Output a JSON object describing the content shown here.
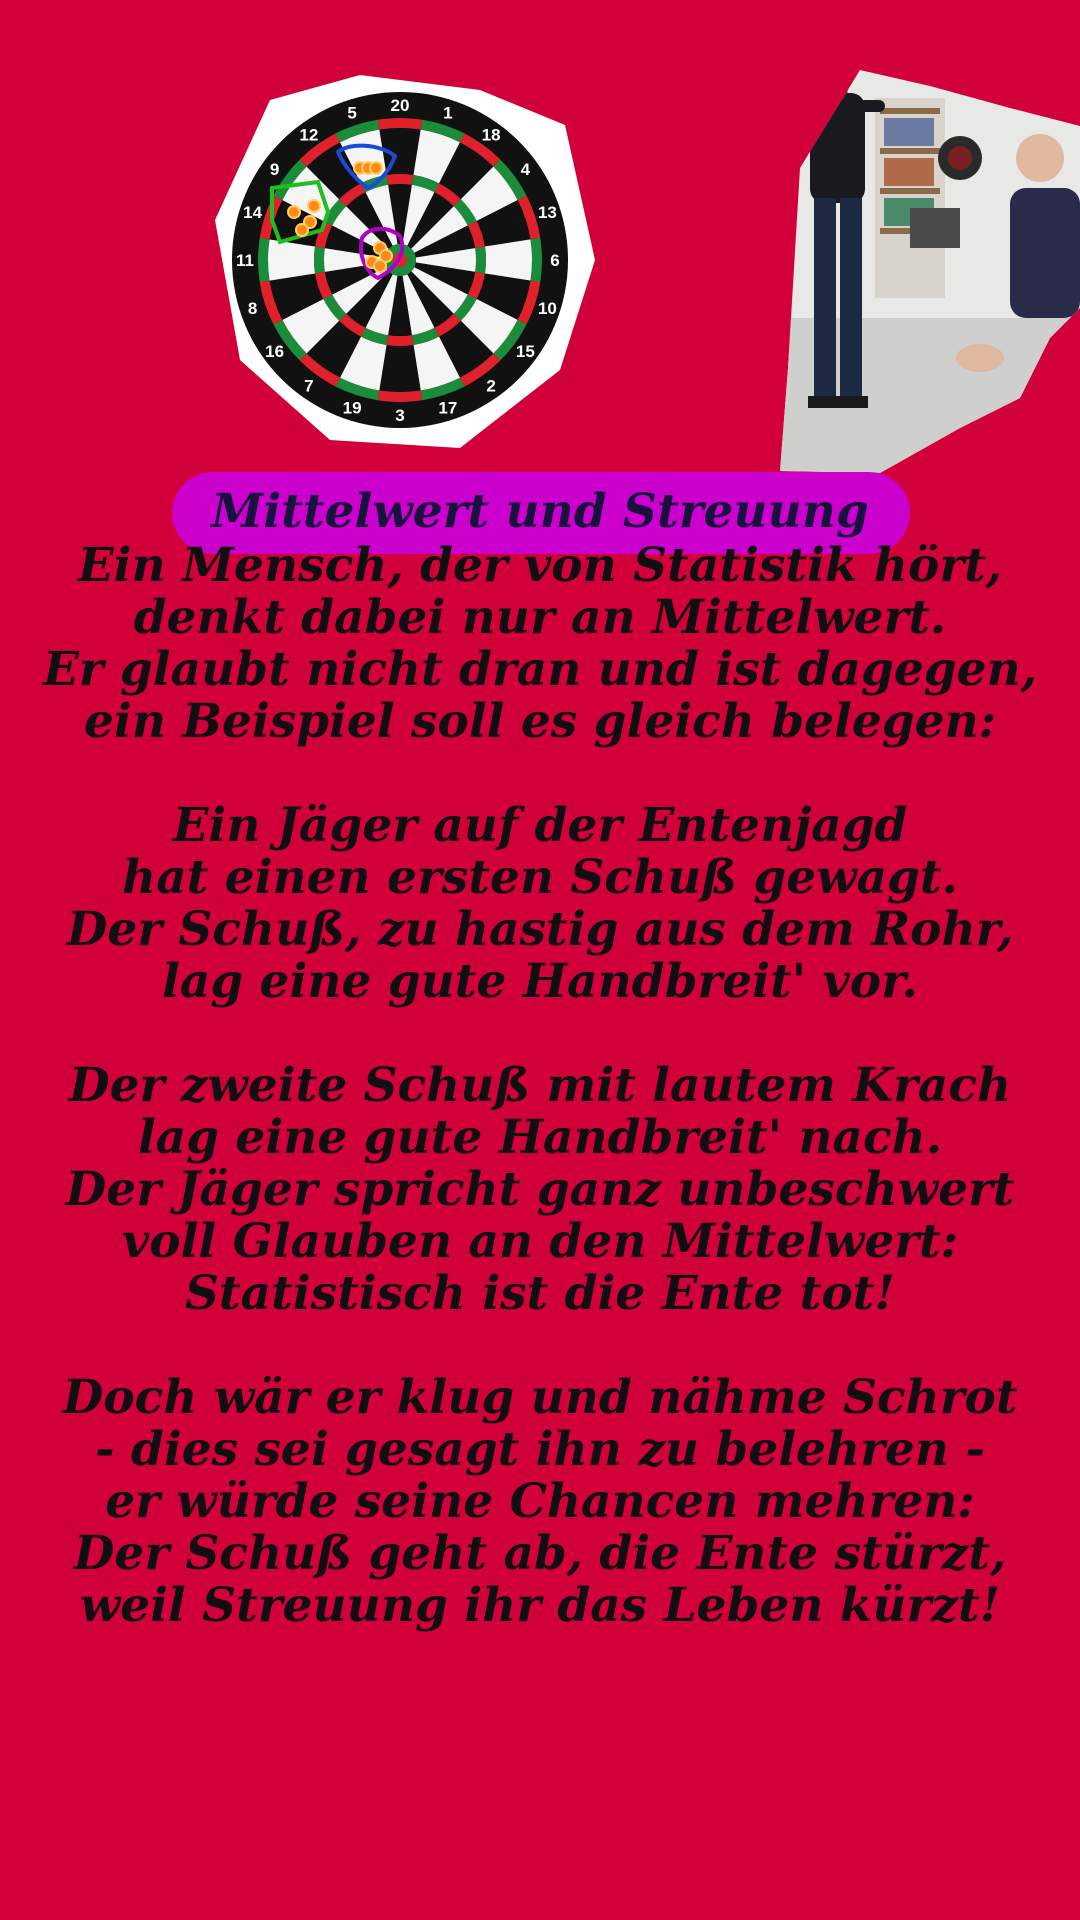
{
  "title": "Mittelwert und Streuung",
  "dartboard": {
    "numbers": [
      "20",
      "1",
      "18",
      "4",
      "13",
      "6",
      "10",
      "15",
      "2",
      "17",
      "3",
      "19",
      "7",
      "16",
      "8",
      "11",
      "14",
      "9",
      "12",
      "5"
    ],
    "colors": {
      "red": "#e0202a",
      "green": "#1a8c3a",
      "black": "#111111",
      "white": "#f5f5f5"
    },
    "group_colors": [
      "#1a4ad8",
      "#1fbf1f",
      "#b000c8"
    ]
  },
  "photo": {
    "icon": "dart-players-photo"
  },
  "poem": {
    "stanzas": [
      [
        "Ein Mensch, der von Statistik hört,",
        "denkt dabei nur an Mittelwert.",
        "Er glaubt nicht dran und ist dagegen,",
        "ein Beispiel soll es gleich belegen:"
      ],
      [
        "Ein Jäger auf der Entenjagd",
        "hat einen ersten Schuß gewagt.",
        "Der Schuß, zu hastig aus dem Rohr,",
        "lag eine gute Handbreit' vor."
      ],
      [
        "Der zweite Schuß mit lautem Krach",
        "lag eine gute Handbreit' nach.",
        "Der Jäger spricht ganz unbeschwert",
        "voll Glauben an den Mittelwert:",
        "Statistisch ist die Ente tot!"
      ],
      [
        "Doch wär er klug und nähme Schrot",
        "- dies sei gesagt ihn zu belehren -",
        "er würde seine Chancen mehren:",
        "Der Schuß geht ab, die Ente stürzt,",
        "weil Streuung ihr das Leben kürzt!"
      ]
    ]
  }
}
